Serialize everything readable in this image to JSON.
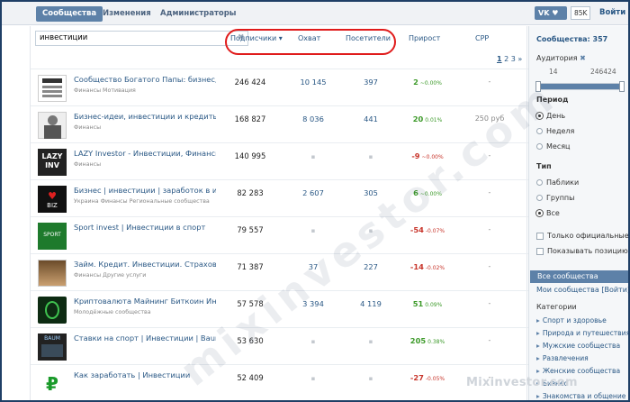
{
  "topbar": {
    "tabs": [
      "Сообщества",
      "Изменения",
      "Администраторы"
    ],
    "vk_label": "VK",
    "count_badge": "85K",
    "login": "Войти"
  },
  "search": {
    "value": "инвестиции",
    "clear": "✖"
  },
  "columns": {
    "subscribers": "Подписчики ▾",
    "reach": "Охват",
    "visitors": "Посетители",
    "growth": "Прирост",
    "cpp": "CPP"
  },
  "pager": {
    "current": "1",
    "pages": [
      "2",
      "3"
    ],
    "next": "»"
  },
  "rows": [
    {
      "name": "Сообщество Богатого Папы: бизнес, и",
      "sub": "Финансы Мотивация",
      "subs": "246 424",
      "reach": "10 145",
      "visitors": "397",
      "growth": "2",
      "growth_pct": "~0.00%",
      "growth_sign": "pos",
      "cpp": "-"
    },
    {
      "name": "Бизнес-идеи, инвестиции и кредиты",
      "sub": "Финансы",
      "subs": "168 827",
      "reach": "8 036",
      "visitors": "441",
      "growth": "20",
      "growth_pct": "0.01%",
      "growth_sign": "pos",
      "cpp": "250 руб"
    },
    {
      "name": "LAZY Investor - Инвестиции, Финансы,",
      "sub": "Финансы",
      "subs": "140 995",
      "reach": "",
      "visitors": "",
      "growth": "-9",
      "growth_pct": "~0.00%",
      "growth_sign": "neg",
      "cpp": "-"
    },
    {
      "name": "Бизнес | инвестиции | заработок в инте",
      "sub": "Украина Финансы Региональные сообщества",
      "subs": "82 283",
      "reach": "2 607",
      "visitors": "305",
      "growth": "6",
      "growth_pct": "~0.00%",
      "growth_sign": "pos",
      "cpp": "-"
    },
    {
      "name": "Sport invest | Инвестиции в спорт",
      "sub": "",
      "subs": "79 557",
      "reach": "",
      "visitors": "",
      "growth": "-54",
      "growth_pct": "-0.07%",
      "growth_sign": "neg",
      "cpp": "-"
    },
    {
      "name": "Займ. Кредит. Инвестиции. Страховані",
      "sub": "Финансы Другие услуги",
      "subs": "71 387",
      "reach": "37",
      "visitors": "227",
      "growth": "-14",
      "growth_pct": "-0.02%",
      "growth_sign": "neg",
      "cpp": "-"
    },
    {
      "name": "Криптовалюта Майнинг Биткоин Инвес",
      "sub": "Молодёжные сообщества",
      "subs": "57 578",
      "reach": "3 394",
      "visitors": "4 119",
      "growth": "51",
      "growth_pct": "0.09%",
      "growth_sign": "pos",
      "cpp": "-"
    },
    {
      "name": "Ставки на спорт | Инвестиции | Baumar",
      "sub": "",
      "subs": "53 630",
      "reach": "",
      "visitors": "",
      "growth": "205",
      "growth_pct": "0.38%",
      "growth_sign": "pos",
      "cpp": "-"
    },
    {
      "name": "Как заработать | Инвестиции",
      "sub": "",
      "subs": "52 409",
      "reach": "",
      "visitors": "",
      "growth": "-27",
      "growth_pct": "-0.05%",
      "growth_sign": "neg",
      "cpp": "-"
    }
  ],
  "sidebar": {
    "count": "Сообщества: 357",
    "audience_label": "Аудитория",
    "audience_min": "14",
    "audience_max": "246424",
    "audience_range_fraction": [
      0,
      1
    ],
    "period_label": "Период",
    "period_options": [
      "День",
      "Неделя",
      "Месяц"
    ],
    "type_label": "Тип",
    "type_options": [
      "Паблики",
      "Группы",
      "Все"
    ],
    "only_official": "Только официальные",
    "show_position": "Показывать позицию",
    "all_communities": "Все сообщества",
    "my_communities": "Мои сообщества [Войти]",
    "categories_label": "Категории",
    "categories": [
      "Спорт и здоровье",
      "Природа и путешествия",
      "Мужские сообщества",
      "Развлечения",
      "Женские сообщества",
      "Бизнес",
      "Знакомства и общение"
    ]
  },
  "watermark": {
    "site": "Mixinvestor.com",
    "diagonal": "mixinvestor.com"
  },
  "colors": {
    "accent": "#5d81a8",
    "link": "#2a5885",
    "positive": "#3d9a2a",
    "negative": "#c8352b",
    "highlight": "#e01b1b"
  }
}
